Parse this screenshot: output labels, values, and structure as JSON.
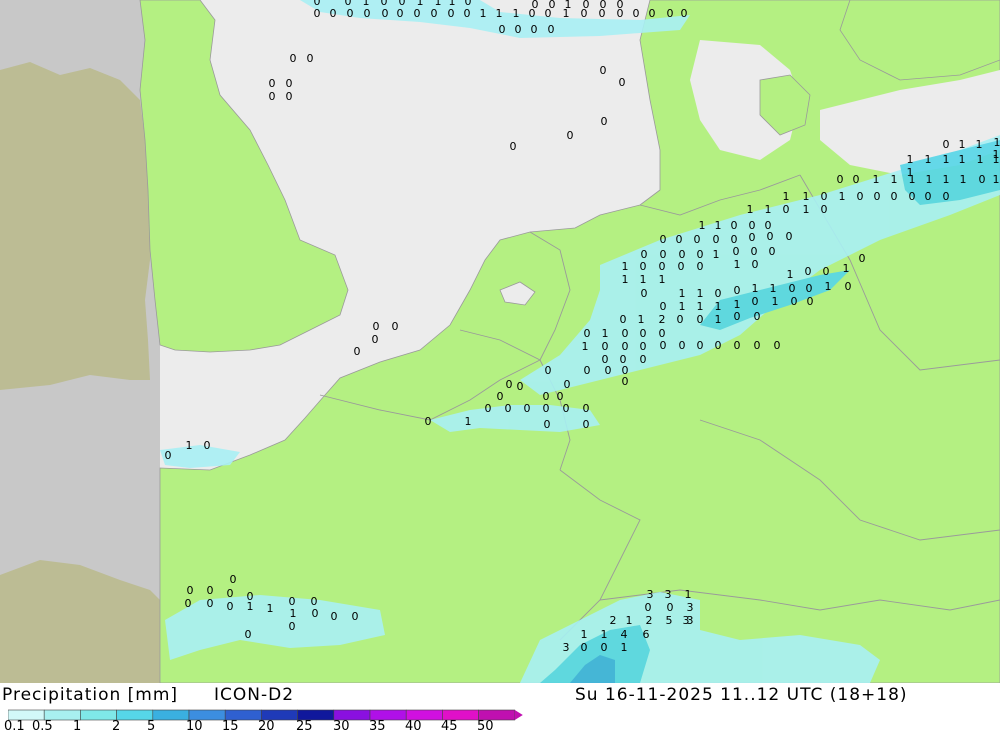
{
  "title": "Precipitation [mm]",
  "model": "ICON-D2",
  "valid_time": "Su 16-11-2025 11..12 UTC (18+18)",
  "legend": {
    "ticks": [
      "0.1",
      "0.5",
      "1",
      "2",
      "5",
      "10",
      "15",
      "20",
      "25",
      "30",
      "35",
      "40",
      "45",
      "50"
    ],
    "colors": [
      "#d2f8f8",
      "#a8f0f0",
      "#7fe8e8",
      "#56d6e8",
      "#3ab0e0",
      "#3c8ee0",
      "#2f60d0",
      "#1f3ab8",
      "#10189c",
      "#8a10e0",
      "#b010e8",
      "#d010e0",
      "#e010c8",
      "#c010b0"
    ]
  },
  "colors": {
    "land": "#b4f082",
    "sea": "#ececec",
    "outside_domain_land": "#bcbc94",
    "outside_domain_sea": "#c8c8c8",
    "precip_light": "#a8f0f4",
    "precip_medium": "#56d6e8",
    "precip_heavy": "#3ab0e0"
  },
  "map_values": [
    "0",
    "0",
    "1",
    "0",
    "0",
    "1",
    "1",
    "1",
    "0",
    "0",
    "0",
    "0",
    "0",
    "0",
    "0",
    "0",
    "0",
    "0",
    "0",
    "1",
    "1",
    "1",
    "0",
    "0",
    "1",
    "0",
    "0",
    "0",
    "0",
    "0",
    "0",
    "0",
    "0",
    "0",
    "0",
    "0",
    "0",
    "0",
    "1",
    "0",
    "0",
    "0",
    "0",
    "0",
    "0",
    "0",
    "0",
    "0",
    "0",
    "0",
    "0",
    "0",
    "0",
    "1",
    "1",
    "1",
    "1",
    "1",
    "1",
    "1",
    "1",
    "1",
    "1",
    "0",
    "0",
    "1",
    "1",
    "1",
    "1",
    "1",
    "1",
    "0",
    "1",
    "1",
    "1",
    "1",
    "1",
    "1",
    "0",
    "1",
    "0",
    "0",
    "0",
    "0",
    "0",
    "0",
    "1",
    "1",
    "0",
    "0",
    "0",
    "0",
    "1",
    "0",
    "0",
    "0",
    "0",
    "0",
    "0",
    "0",
    "0",
    "0",
    "0",
    "0",
    "0",
    "0",
    "1",
    "0",
    "0",
    "0",
    "1",
    "0",
    "0",
    "0",
    "0",
    "1",
    "1",
    "1",
    "1",
    "0",
    "1",
    "0",
    "0",
    "1",
    "0",
    "0",
    "1",
    "1",
    "0",
    "0",
    "1",
    "1",
    "0",
    "0",
    "1",
    "0",
    "0",
    "1",
    "1",
    "1",
    "1",
    "0",
    "1",
    "0",
    "0",
    "0",
    "1",
    "2",
    "0",
    "0",
    "1",
    "0",
    "0",
    "0",
    "1",
    "0",
    "0",
    "0",
    "1",
    "0",
    "0",
    "0",
    "0",
    "0",
    "0",
    "0",
    "0",
    "0",
    "0",
    "0",
    "0",
    "0",
    "0",
    "0",
    "0",
    "0",
    "0",
    "0",
    "0",
    "0",
    "0",
    "0",
    "0",
    "0",
    "0",
    "0",
    "0",
    "0",
    "1",
    "0",
    "0",
    "0",
    "0",
    "0",
    "0",
    "0",
    "0",
    "0",
    "1",
    "0",
    "0",
    "0",
    "0",
    "0",
    "0",
    "0",
    "1",
    "0",
    "0",
    "0",
    "0",
    "0",
    "0",
    "0",
    "1",
    "1",
    "0",
    "0",
    "0",
    "3",
    "3",
    "1",
    "0",
    "0",
    "3",
    "3",
    "2",
    "1",
    "2",
    "5",
    "3",
    "1",
    "1",
    "4",
    "6",
    "3",
    "0",
    "0",
    "1",
    "0",
    "0",
    "1",
    "0",
    "0",
    "0",
    "1",
    "0",
    "0",
    "1",
    "1",
    "0",
    "0",
    "0"
  ]
}
